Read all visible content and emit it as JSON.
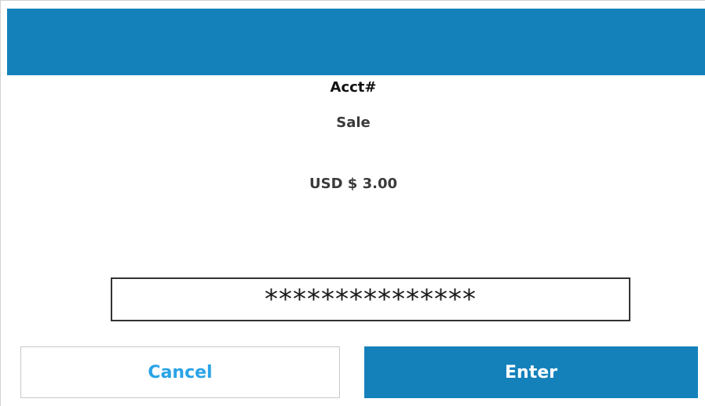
{
  "header": {
    "color": "#1481bb"
  },
  "prompt": {
    "title": "Acct#",
    "transaction_type": "Sale",
    "amount": "USD $ 3.00"
  },
  "account_input": {
    "value": "***************"
  },
  "buttons": {
    "cancel_label": "Cancel",
    "enter_label": "Enter"
  },
  "colors": {
    "accent": "#1481bb",
    "cancel_text": "#2aa3e6",
    "background": "#ffffff"
  }
}
